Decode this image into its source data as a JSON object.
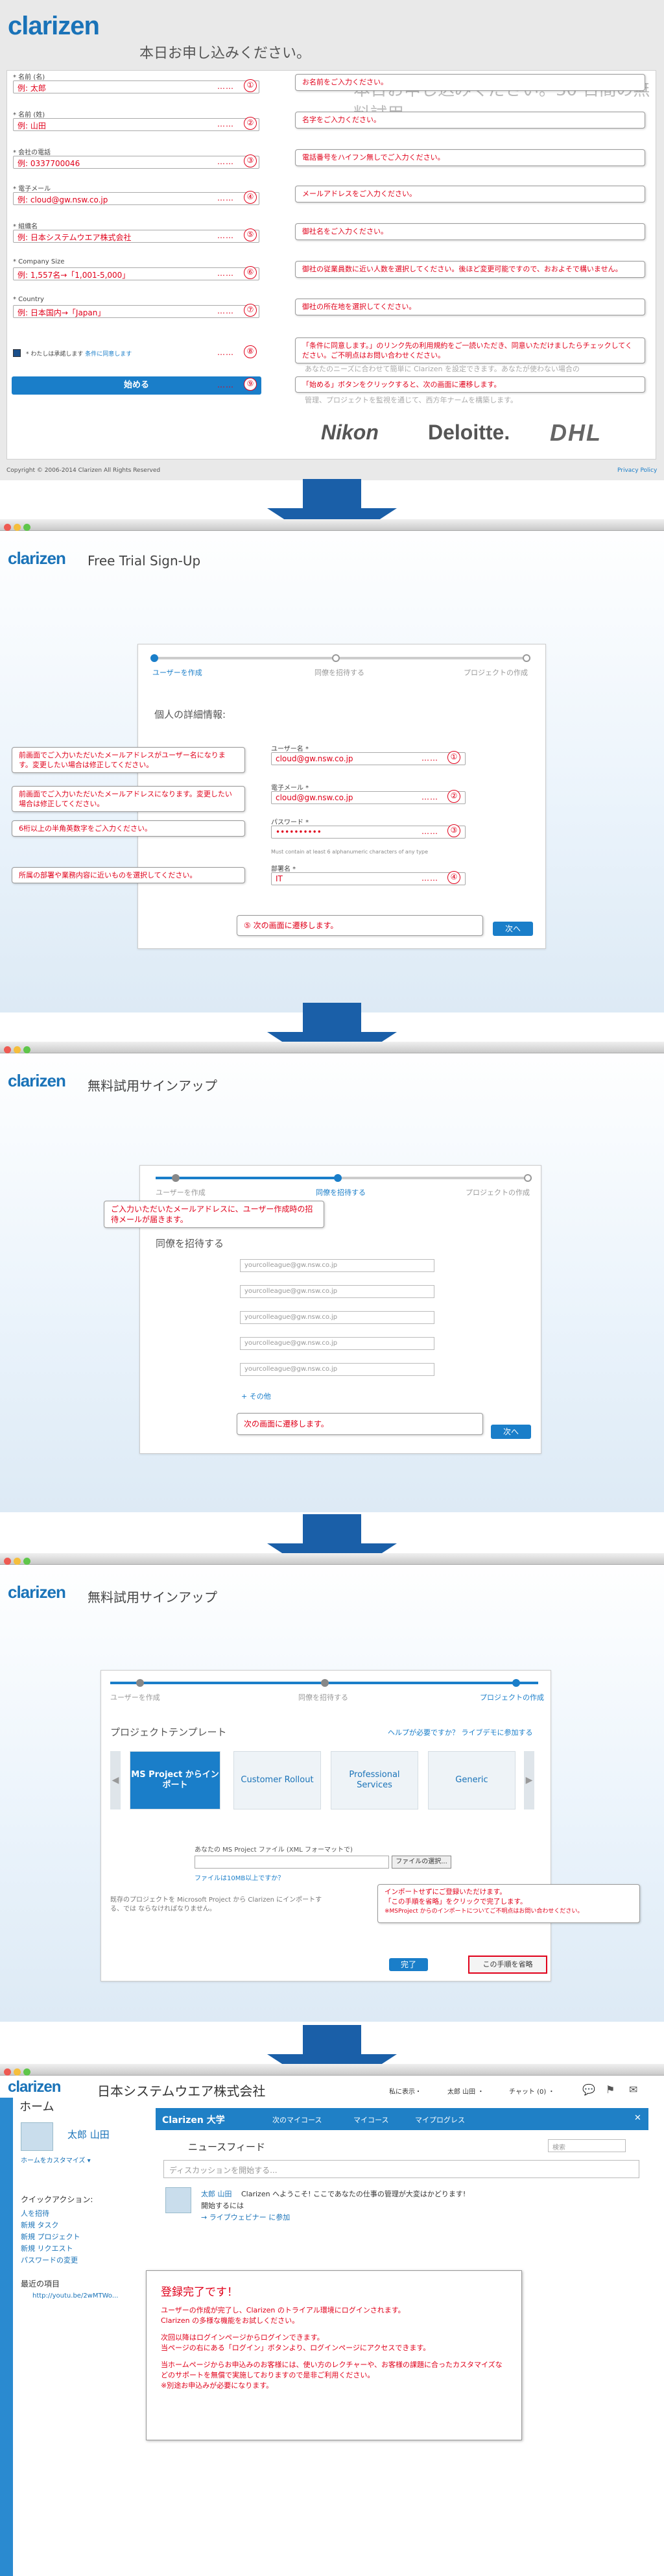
{
  "s1": {
    "title": "本日お申し込みください。",
    "fields": [
      {
        "label": "* 名前 (名)",
        "value": "例: 太郎",
        "note": "お名前をご入力ください。",
        "n": "①"
      },
      {
        "label": "* 名前 (姓)",
        "value": "例: 山田",
        "note": "名字をご入力ください。",
        "n": "②"
      },
      {
        "label": "* 会社の電話",
        "value": "例: 0337700046",
        "note": "電話番号をハイフン無しでご入力ください。",
        "n": "③"
      },
      {
        "label": "* 電子メール",
        "value": "例: cloud@gw.nsw.co.jp",
        "note": "メールアドレスをご入力ください。",
        "n": "④"
      },
      {
        "label": "* 組織名",
        "value": "例: 日本システムウエア株式会社",
        "note": "御社名をご入力ください。",
        "n": "⑤"
      },
      {
        "label": "* Company Size",
        "value": "例: 1,557名→「1,001-5,000」",
        "note": "御社の従業員数に近い人数を選択してください。後ほど変更可能ですので、おおよそで構いません。",
        "n": "⑥"
      },
      {
        "label": "* Country",
        "value": "例: 日本国内→「Japan」",
        "note": "御社の所在地を選択してください。",
        "n": "⑦"
      }
    ],
    "agree": "* わたしは承諾します",
    "agree_link": "条件に同意します",
    "agree_note": "「条件に同意します。」のリンク先の利用規約をご一読いただき、同意いただけましたらチェックしてください。ご不明点はお問い合わせください。",
    "agree_n": "⑧",
    "start": "始める",
    "start_note": "「始める」ボタンをクリックすると、次の画面に遷移します。",
    "start_n": "⑨",
    "bg_text1": "本日お申し込みください。30 日間の無料試用",
    "bg_text2": "あなたのニーズに合わせて簡単に Clarizen を設定できます。あなたが使わない場合の",
    "bg_text3": "管理、プロジェクトを監視を通じて、西方年ナームを構築します。",
    "logos": [
      "Nikon",
      "Deloitte.",
      "DHL"
    ],
    "copyright": "Copyright © 2006-2014 Clarizen All Rights Reserved",
    "policy": "Privacy Policy"
  },
  "s2": {
    "title": "Free Trial Sign-Up",
    "steps": [
      "ユーザーを作成",
      "同僚を招待する",
      "プロジェクトの作成"
    ],
    "heading": "個人の詳細情報:",
    "fields": [
      {
        "label": "ユーザー名 *",
        "value": "cloud@gw.nsw.co.jp",
        "n": "①",
        "note": "前画面でご入力いただいたメールアドレスがユーザー名になります。変更したい場合は修正してください。"
      },
      {
        "label": "電子メール *",
        "value": "cloud@gw.nsw.co.jp",
        "n": "②",
        "note": "前画面でご入力いただいたメールアドレスになります。変更したい場合は修正してください。"
      },
      {
        "label": "パスワード *",
        "value": "••••••••••",
        "n": "③",
        "note": "6桁以上の半角英数字をご入力ください。"
      },
      {
        "label": "部署名 *",
        "value": "IT",
        "n": "④",
        "note": "所属の部署や業務内容に近いものを選択してください。"
      }
    ],
    "pw_hint": "Must contain at least 6 alphanumeric characters of any type",
    "next_note": "⑤ 次の画面に遷移します。",
    "next": "次へ"
  },
  "s3": {
    "title": "無料試用サインアップ",
    "steps": [
      "ユーザーを作成",
      "同僚を招待する",
      "プロジェクトの作成"
    ],
    "note": "ご入力いただいたメールアドレスに、ユーザー作成時の招待メールが届きます。",
    "heading": "同僚を招待する",
    "placeholder": "yourcolleague@gw.nsw.co.jp",
    "more": "+ その他",
    "next_note": "次の画面に遷移します。",
    "next": "次へ"
  },
  "s4": {
    "title": "無料試用サインアップ",
    "steps": [
      "ユーザーを作成",
      "同僚を招待する",
      "プロジェクトの作成"
    ],
    "heading": "プロジェクトテンプレート",
    "help": "ヘルプが必要ですか？ ライブデモに参加する",
    "tiles": [
      "MS Project からインポート",
      "Customer Rollout",
      "Professional Services",
      "Generic"
    ],
    "file_label": "あなたの MS Project ファイル (XML フォーマットで)",
    "file_btn": "ファイルの選択...",
    "file_hint": "ファイルは10MB以上ですか？",
    "bottom": "既存のプロジェクトを Microsoft Project から Clarizen にインポートする、では ならなければなりません。",
    "done": "完了",
    "skip": "この手順を省略",
    "note1": "インポートせずにご登録いただけます。",
    "note2": "「この手順を省略」をクリックで完了します。",
    "note3": "※MSProject からのインポートについてご不明点はお問い合わせください。"
  },
  "s5": {
    "company": "日本システムウエア株式会社",
    "top_links": [
      "私に表示・",
      "太郎 山田 ・",
      "チャット (0) ・"
    ],
    "home": "ホーム",
    "user": "太郎 山田",
    "customize": "ホームをカスタマイズ ▾",
    "quick": "クイックアクション:",
    "quick_items": [
      "人を招待",
      "新規 タスク",
      "新規 プロジェクト",
      "新規 リクエスト",
      "パスワードの変更"
    ],
    "recent": "最近の項目",
    "recent_item": "http://youtu.be/2wMTWo...",
    "univ": "Clarizen 大学",
    "univ_tabs": [
      "次のマイコース",
      "マイコース",
      "マイプログレス"
    ],
    "feed": "ニュースフィード",
    "search": "検索",
    "discuss": "ディスカッションを開始する...",
    "post_user": "太郎 山田",
    "post_text": "Clarizen へようこそ! ここであなたの仕事の管理が大変はかどります!",
    "post_start": "開始するには",
    "post_link": "→ ライブウェビナー に参加",
    "done_title": "登録完了です！",
    "done_lines": [
      "ユーザーの作成が完了し、Clarizen のトライアル環境にログインされます。",
      "Clarizen の多様な機能をお試しください。",
      "次回以降はログインページからログインできます。",
      "当ページの右にある「ログイン」ボタンより、ログインページにアクセスできます。",
      "当ホームページからお申込みのお客様には、使い方のレクチャーや、お客様の課題に合ったカスタマイズなどのサポートを無償で実施しておりますので是非ご利用ください。",
      "※別途お申込みが必要になります。"
    ]
  },
  "colors": {
    "brand": "#1a73b8",
    "accent": "#1a7ec9",
    "annot": "#e0001a"
  }
}
